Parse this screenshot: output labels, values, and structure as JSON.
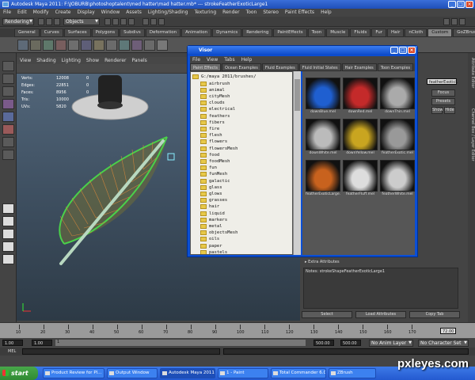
{
  "title": "Autodesk Maya 2011: F:\\JOBURB\\photoshoptalent\\med hatter\\mad hatter.mb* --- strokeFeatherExoticLarge1",
  "menubar": [
    "File",
    "Edit",
    "Modify",
    "Create",
    "Display",
    "Window",
    "Assets",
    "Lighting/Shading",
    "Texturing",
    "Render",
    "Toon",
    "Stereo",
    "Paint Effects",
    "Help"
  ],
  "status": {
    "menuset": "Rendering",
    "objects": "Objects"
  },
  "shelf_tabs": [
    "General",
    "Curves",
    "Surfaces",
    "Polygons",
    "Subdivs",
    "Deformation",
    "Animation",
    "Dynamics",
    "Rendering",
    "PaintEffects",
    "Toon",
    "Muscle",
    "Fluids",
    "Fur",
    "Hair",
    "nCloth",
    "Custom",
    "GoZBrush"
  ],
  "shelf_active": "Custom",
  "viewport_menu": [
    "View",
    "Shading",
    "Lighting",
    "Show",
    "Renderer",
    "Panels"
  ],
  "hud": [
    {
      "label": "Verts:",
      "v1": "12008",
      "v2": "0",
      "v3": "0"
    },
    {
      "label": "Edges:",
      "v1": "22851",
      "v2": "0",
      "v3": "0"
    },
    {
      "label": "Faces:",
      "v1": "8956",
      "v2": "0",
      "v3": "0"
    },
    {
      "label": "Tris:",
      "v1": "10000",
      "v2": "0",
      "v3": "0"
    },
    {
      "label": "UVs:",
      "v1": "5820",
      "v2": "0",
      "v3": "0"
    }
  ],
  "visor": {
    "title": "Visor",
    "menu": [
      "File",
      "View",
      "Tabs",
      "Help"
    ],
    "tabs": [
      "Paint Effects",
      "Ocean Examples",
      "Fluid Examples",
      "Fluid Initial States",
      "Hair Examples",
      "Toon Examples"
    ],
    "root": "G:/maya 2011/brushes/",
    "folders": [
      "airbrush",
      "animal",
      "cityMesh",
      "clouds",
      "electrical",
      "feathers",
      "fibers",
      "fire",
      "flesh",
      "flowers",
      "flowersMesh",
      "food",
      "foodMesh",
      "fun",
      "funMesh",
      "galactic",
      "glass",
      "glows",
      "grasses",
      "hair",
      "liquid",
      "markers",
      "metal",
      "objectsMesh",
      "oils",
      "paper",
      "pastels"
    ],
    "thumbs": [
      {
        "label": "downBlue.mel",
        "color": "#1f5fd0"
      },
      {
        "label": "downRed.mel",
        "color": "#c42a2a"
      },
      {
        "label": "downThin.mel",
        "color": "#aaaaaa"
      },
      {
        "label": "downWhite.mel",
        "color": "#bbbbbb"
      },
      {
        "label": "downYellow.mel",
        "color": "#c9a520"
      },
      {
        "label": "featherExotic.mel",
        "color": "#999999"
      },
      {
        "label": "featherExoticLarge.mel",
        "color": "#c8621e"
      },
      {
        "label": "featherFluff.mel",
        "color": "#dddddd"
      },
      {
        "label": "featherWhite.mel",
        "color": "#cccccc"
      }
    ]
  },
  "attr": {
    "field": "featherExoticL",
    "btn_focus": "Focus",
    "btn_presets": "Presets",
    "btn_show": "Show",
    "btn_hide": "Hide",
    "extra": "Extra Attributes",
    "notes": "Notes: strokeShapeFeatherExoticLarge1",
    "select": "Select",
    "load": "Load Attributes",
    "copy": "Copy Tab"
  },
  "right_tabs": [
    "Attribute Editor",
    "Channel Box / Layer Editor"
  ],
  "timeline": {
    "ticks": [
      "10",
      "20",
      "30",
      "40",
      "50",
      "60",
      "70",
      "80",
      "90",
      "100",
      "110",
      "120",
      "130",
      "140",
      "150",
      "160",
      "170"
    ],
    "current": "72.00"
  },
  "range": {
    "start": "1.00",
    "start2": "1.00",
    "current": "1",
    "end": "500.00",
    "end2": "500.00",
    "anim_layer": "No Anim Layer",
    "char_set": "No Character Set"
  },
  "mel_label": "MEL",
  "taskbar": {
    "start": "start",
    "tasks": [
      "Product Review for Pl...",
      "Output Window",
      "Autodesk Maya 2011: ...",
      "1 - Paint",
      "Total Commander 6.0...",
      "ZBrush"
    ],
    "active": 2
  },
  "watermark": "pxleyes.com"
}
